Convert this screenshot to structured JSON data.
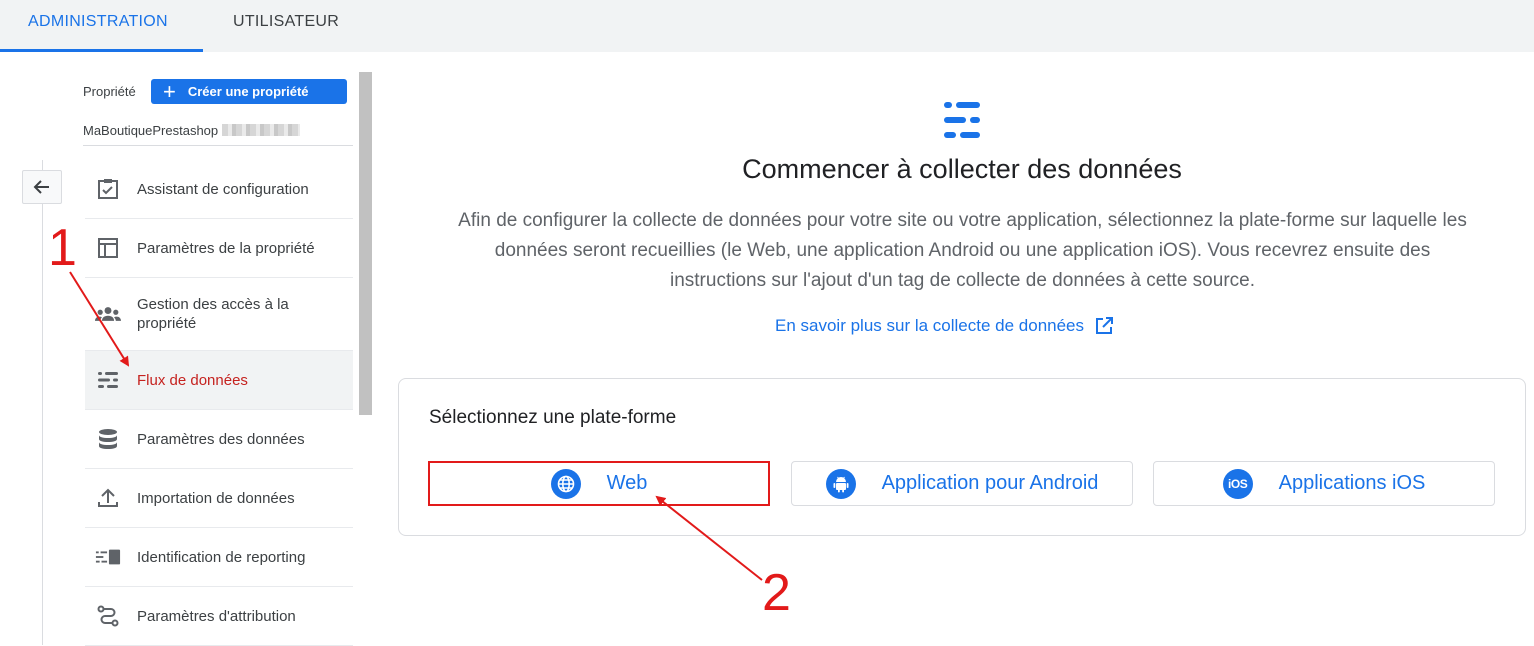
{
  "tabs": {
    "admin": "ADMINISTRATION",
    "user": "UTILISATEUR"
  },
  "property": {
    "label": "Propriété",
    "create_button": "Créer une propriété",
    "name": "MaBoutiquePrestashop"
  },
  "menu": [
    {
      "label": "Assistant de configuration",
      "icon": "checklist-icon"
    },
    {
      "label": "Paramètres de la propriété",
      "icon": "layout-icon"
    },
    {
      "label": "Gestion des accès à la propriété",
      "icon": "group-icon"
    },
    {
      "label": "Flux de données",
      "icon": "data-streams-icon",
      "active": true
    },
    {
      "label": "Paramètres des données",
      "icon": "database-icon"
    },
    {
      "label": "Importation de données",
      "icon": "upload-icon"
    },
    {
      "label": "Identification de reporting",
      "icon": "reporting-id-icon"
    },
    {
      "label": "Paramètres d'attribution",
      "icon": "attribution-icon"
    }
  ],
  "main": {
    "title": "Commencer à collecter des données",
    "description": "Afin de configurer la collecte de données pour votre site ou votre application, sélectionnez la plate-forme sur laquelle les données seront recueillies (le Web, une application Android ou une application iOS). Vous recevrez ensuite des instructions sur l'ajout d'un tag de collecte de données à cette source.",
    "learn_more": "En savoir plus sur la collecte de données",
    "platform_title": "Sélectionnez une plate-forme",
    "platforms": {
      "web": "Web",
      "android": "Application pour Android",
      "ios": "Applications iOS",
      "ios_badge": "iOS"
    }
  },
  "annotations": {
    "one": "1",
    "two": "2"
  },
  "colors": {
    "accent": "#1a73e8",
    "annotation": "#e21a1a",
    "active_text": "#c5221f"
  }
}
